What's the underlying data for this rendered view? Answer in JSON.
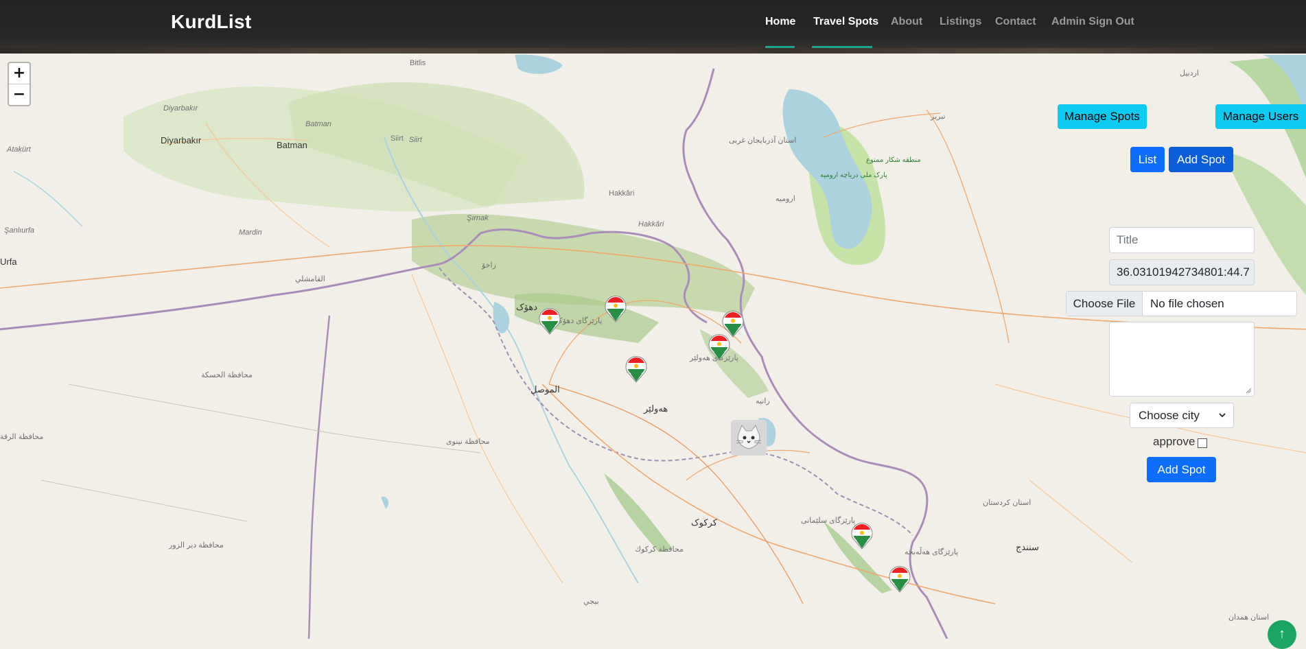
{
  "navbar": {
    "brand": "KurdList",
    "links": [
      {
        "label": "Home",
        "active": true
      },
      {
        "label": "Travel Spots",
        "active": true
      },
      {
        "label": "About",
        "active": false
      },
      {
        "label": "Listings",
        "active": false
      },
      {
        "label": "Contact",
        "active": false
      },
      {
        "label": "Admin Sign Out",
        "active": false
      }
    ],
    "accent": "#1aa58a"
  },
  "map": {
    "zoom_in": "+",
    "zoom_out": "−",
    "labels": {
      "bitlis": "Bitlis",
      "diyarbakir_small": "Diyarbakır",
      "diyarbakir": "Diyarbakır",
      "batman_small": "Batman",
      "batman": "Batman",
      "siirt_small": "Siirt",
      "siirt": "Siirt",
      "atakurt": "Atakürt",
      "sanliurfa": "Şanlıurfa",
      "urfa": "Urfa",
      "mardin": "Mardin",
      "sirnak": "Şırnak",
      "hakkari": "Hakkâri",
      "hakkari2": "Hakkâri",
      "qamishli": "القامشلي",
      "duhok": "دهۆک",
      "mosul": "الموصل",
      "erbil": "هەولێر",
      "kirkuk": "کرکوک",
      "sulaymaniyah": "پارێزگای سلێمانی",
      "halabja": "پارێزگای هەڵەبجە",
      "sanandaj": "سنندج",
      "urmia": "ارومیه",
      "tabriz": "تبریز",
      "ardabil": "اردبیل",
      "west_azerbaijan": "استان آذربایجان غربی",
      "kurdistan_province": "استان کردستان",
      "hamadan": "استان همدان",
      "lake_urmia_park": "پارک ملی دریاچه ارومیه",
      "protected_area": "منطقه شکار ممنوع",
      "hasakah": "محافظة الحسكة",
      "raqqa": "محافظة الرقة",
      "deir": "محافظة دير الزور",
      "nineveh": "محافظة نينوى",
      "kirkuk_gov": "محافظة كركوك",
      "baiji": "بيجي",
      "erbil_prov": "پارێزگای هەولێر",
      "duhok_prov": "پارێزگای دهۆک",
      "zakho": "زاخۆ",
      "rania": "رانیه"
    }
  },
  "admin": {
    "manage_spots": "Manage Spots",
    "manage_users": "Manage Users",
    "list": "List",
    "add_spot_top": "Add Spot",
    "title_placeholder": "Title",
    "coords_value": "36.03101942734801:44.7",
    "choose_file": "Choose File",
    "no_file": "No file chosen",
    "description_value": "",
    "city_select": "Choose city",
    "approve_label": "approve",
    "add_spot_submit": "Add Spot"
  },
  "colors": {
    "info": "#0dcaf0",
    "primary": "#0d6efd",
    "scroll_top": "#1aa562"
  }
}
